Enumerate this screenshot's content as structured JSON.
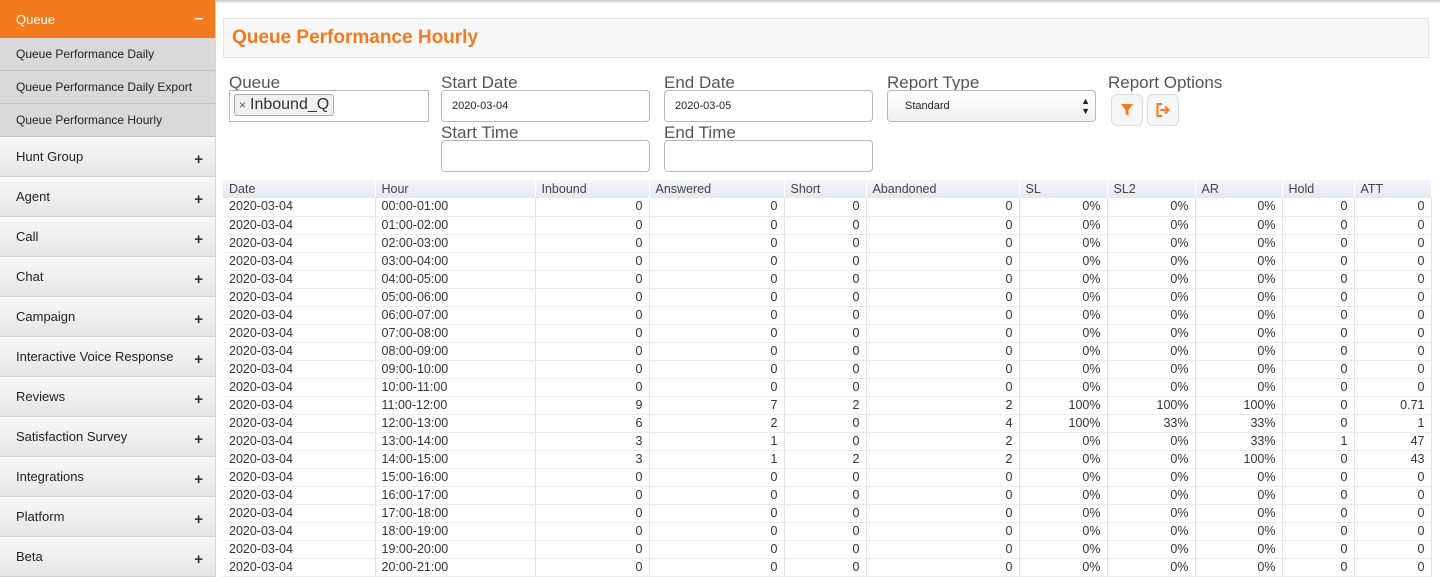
{
  "sidebar": {
    "active_section": {
      "label": "Queue",
      "sign": "–"
    },
    "sub_items": [
      {
        "label": "Queue Performance Daily"
      },
      {
        "label": "Queue Performance Daily Export"
      },
      {
        "label": "Queue Performance Hourly"
      }
    ],
    "items": [
      {
        "label": "Hunt Group",
        "sign": "+"
      },
      {
        "label": "Agent",
        "sign": "+"
      },
      {
        "label": "Call",
        "sign": "+"
      },
      {
        "label": "Chat",
        "sign": "+"
      },
      {
        "label": "Campaign",
        "sign": "+"
      },
      {
        "label": "Interactive Voice Response",
        "sign": "+"
      },
      {
        "label": "Reviews",
        "sign": "+"
      },
      {
        "label": "Satisfaction Survey",
        "sign": "+"
      },
      {
        "label": "Integrations",
        "sign": "+"
      },
      {
        "label": "Platform",
        "sign": "+"
      },
      {
        "label": "Beta",
        "sign": "+"
      }
    ]
  },
  "page": {
    "title": "Queue Performance Hourly",
    "accent_color": "#f47a20"
  },
  "filters": {
    "queue_label": "Queue",
    "queue_tag": "Inbound_Q",
    "queue_tag_remove": "×",
    "start_date_label": "Start Date",
    "start_date_value": "2020-03-04",
    "end_date_label": "End Date",
    "end_date_value": "2020-03-05",
    "start_time_label": "Start Time",
    "start_time_value": "",
    "end_time_label": "End Time",
    "end_time_value": "",
    "report_type_label": "Report Type",
    "report_type_value": "Standard",
    "report_options_label": "Report Options",
    "filter_icon": "filter-icon",
    "export_icon": "export-icon"
  },
  "table": {
    "columns": [
      "Date",
      "Hour",
      "Inbound",
      "Answered",
      "Short",
      "Abandoned",
      "SL",
      "SL2",
      "AR",
      "Hold",
      "ATT"
    ],
    "rows": [
      [
        "2020-03-04",
        "00:00-01:00",
        "0",
        "0",
        "0",
        "0",
        "0%",
        "0%",
        "0%",
        "0",
        "0"
      ],
      [
        "2020-03-04",
        "01:00-02:00",
        "0",
        "0",
        "0",
        "0",
        "0%",
        "0%",
        "0%",
        "0",
        "0"
      ],
      [
        "2020-03-04",
        "02:00-03:00",
        "0",
        "0",
        "0",
        "0",
        "0%",
        "0%",
        "0%",
        "0",
        "0"
      ],
      [
        "2020-03-04",
        "03:00-04:00",
        "0",
        "0",
        "0",
        "0",
        "0%",
        "0%",
        "0%",
        "0",
        "0"
      ],
      [
        "2020-03-04",
        "04:00-05:00",
        "0",
        "0",
        "0",
        "0",
        "0%",
        "0%",
        "0%",
        "0",
        "0"
      ],
      [
        "2020-03-04",
        "05:00-06:00",
        "0",
        "0",
        "0",
        "0",
        "0%",
        "0%",
        "0%",
        "0",
        "0"
      ],
      [
        "2020-03-04",
        "06:00-07:00",
        "0",
        "0",
        "0",
        "0",
        "0%",
        "0%",
        "0%",
        "0",
        "0"
      ],
      [
        "2020-03-04",
        "07:00-08:00",
        "0",
        "0",
        "0",
        "0",
        "0%",
        "0%",
        "0%",
        "0",
        "0"
      ],
      [
        "2020-03-04",
        "08:00-09:00",
        "0",
        "0",
        "0",
        "0",
        "0%",
        "0%",
        "0%",
        "0",
        "0"
      ],
      [
        "2020-03-04",
        "09:00-10:00",
        "0",
        "0",
        "0",
        "0",
        "0%",
        "0%",
        "0%",
        "0",
        "0"
      ],
      [
        "2020-03-04",
        "10:00-11:00",
        "0",
        "0",
        "0",
        "0",
        "0%",
        "0%",
        "0%",
        "0",
        "0"
      ],
      [
        "2020-03-04",
        "11:00-12:00",
        "9",
        "7",
        "2",
        "2",
        "100%",
        "100%",
        "100%",
        "0",
        "0.71"
      ],
      [
        "2020-03-04",
        "12:00-13:00",
        "6",
        "2",
        "0",
        "4",
        "100%",
        "33%",
        "33%",
        "0",
        "1"
      ],
      [
        "2020-03-04",
        "13:00-14:00",
        "3",
        "1",
        "0",
        "2",
        "0%",
        "0%",
        "33%",
        "1",
        "47"
      ],
      [
        "2020-03-04",
        "14:00-15:00",
        "3",
        "1",
        "2",
        "2",
        "0%",
        "0%",
        "100%",
        "0",
        "43"
      ],
      [
        "2020-03-04",
        "15:00-16:00",
        "0",
        "0",
        "0",
        "0",
        "0%",
        "0%",
        "0%",
        "0",
        "0"
      ],
      [
        "2020-03-04",
        "16:00-17:00",
        "0",
        "0",
        "0",
        "0",
        "0%",
        "0%",
        "0%",
        "0",
        "0"
      ],
      [
        "2020-03-04",
        "17:00-18:00",
        "0",
        "0",
        "0",
        "0",
        "0%",
        "0%",
        "0%",
        "0",
        "0"
      ],
      [
        "2020-03-04",
        "18:00-19:00",
        "0",
        "0",
        "0",
        "0",
        "0%",
        "0%",
        "0%",
        "0",
        "0"
      ],
      [
        "2020-03-04",
        "19:00-20:00",
        "0",
        "0",
        "0",
        "0",
        "0%",
        "0%",
        "0%",
        "0",
        "0"
      ],
      [
        "2020-03-04",
        "20:00-21:00",
        "0",
        "0",
        "0",
        "0",
        "0%",
        "0%",
        "0%",
        "0",
        "0"
      ]
    ]
  }
}
